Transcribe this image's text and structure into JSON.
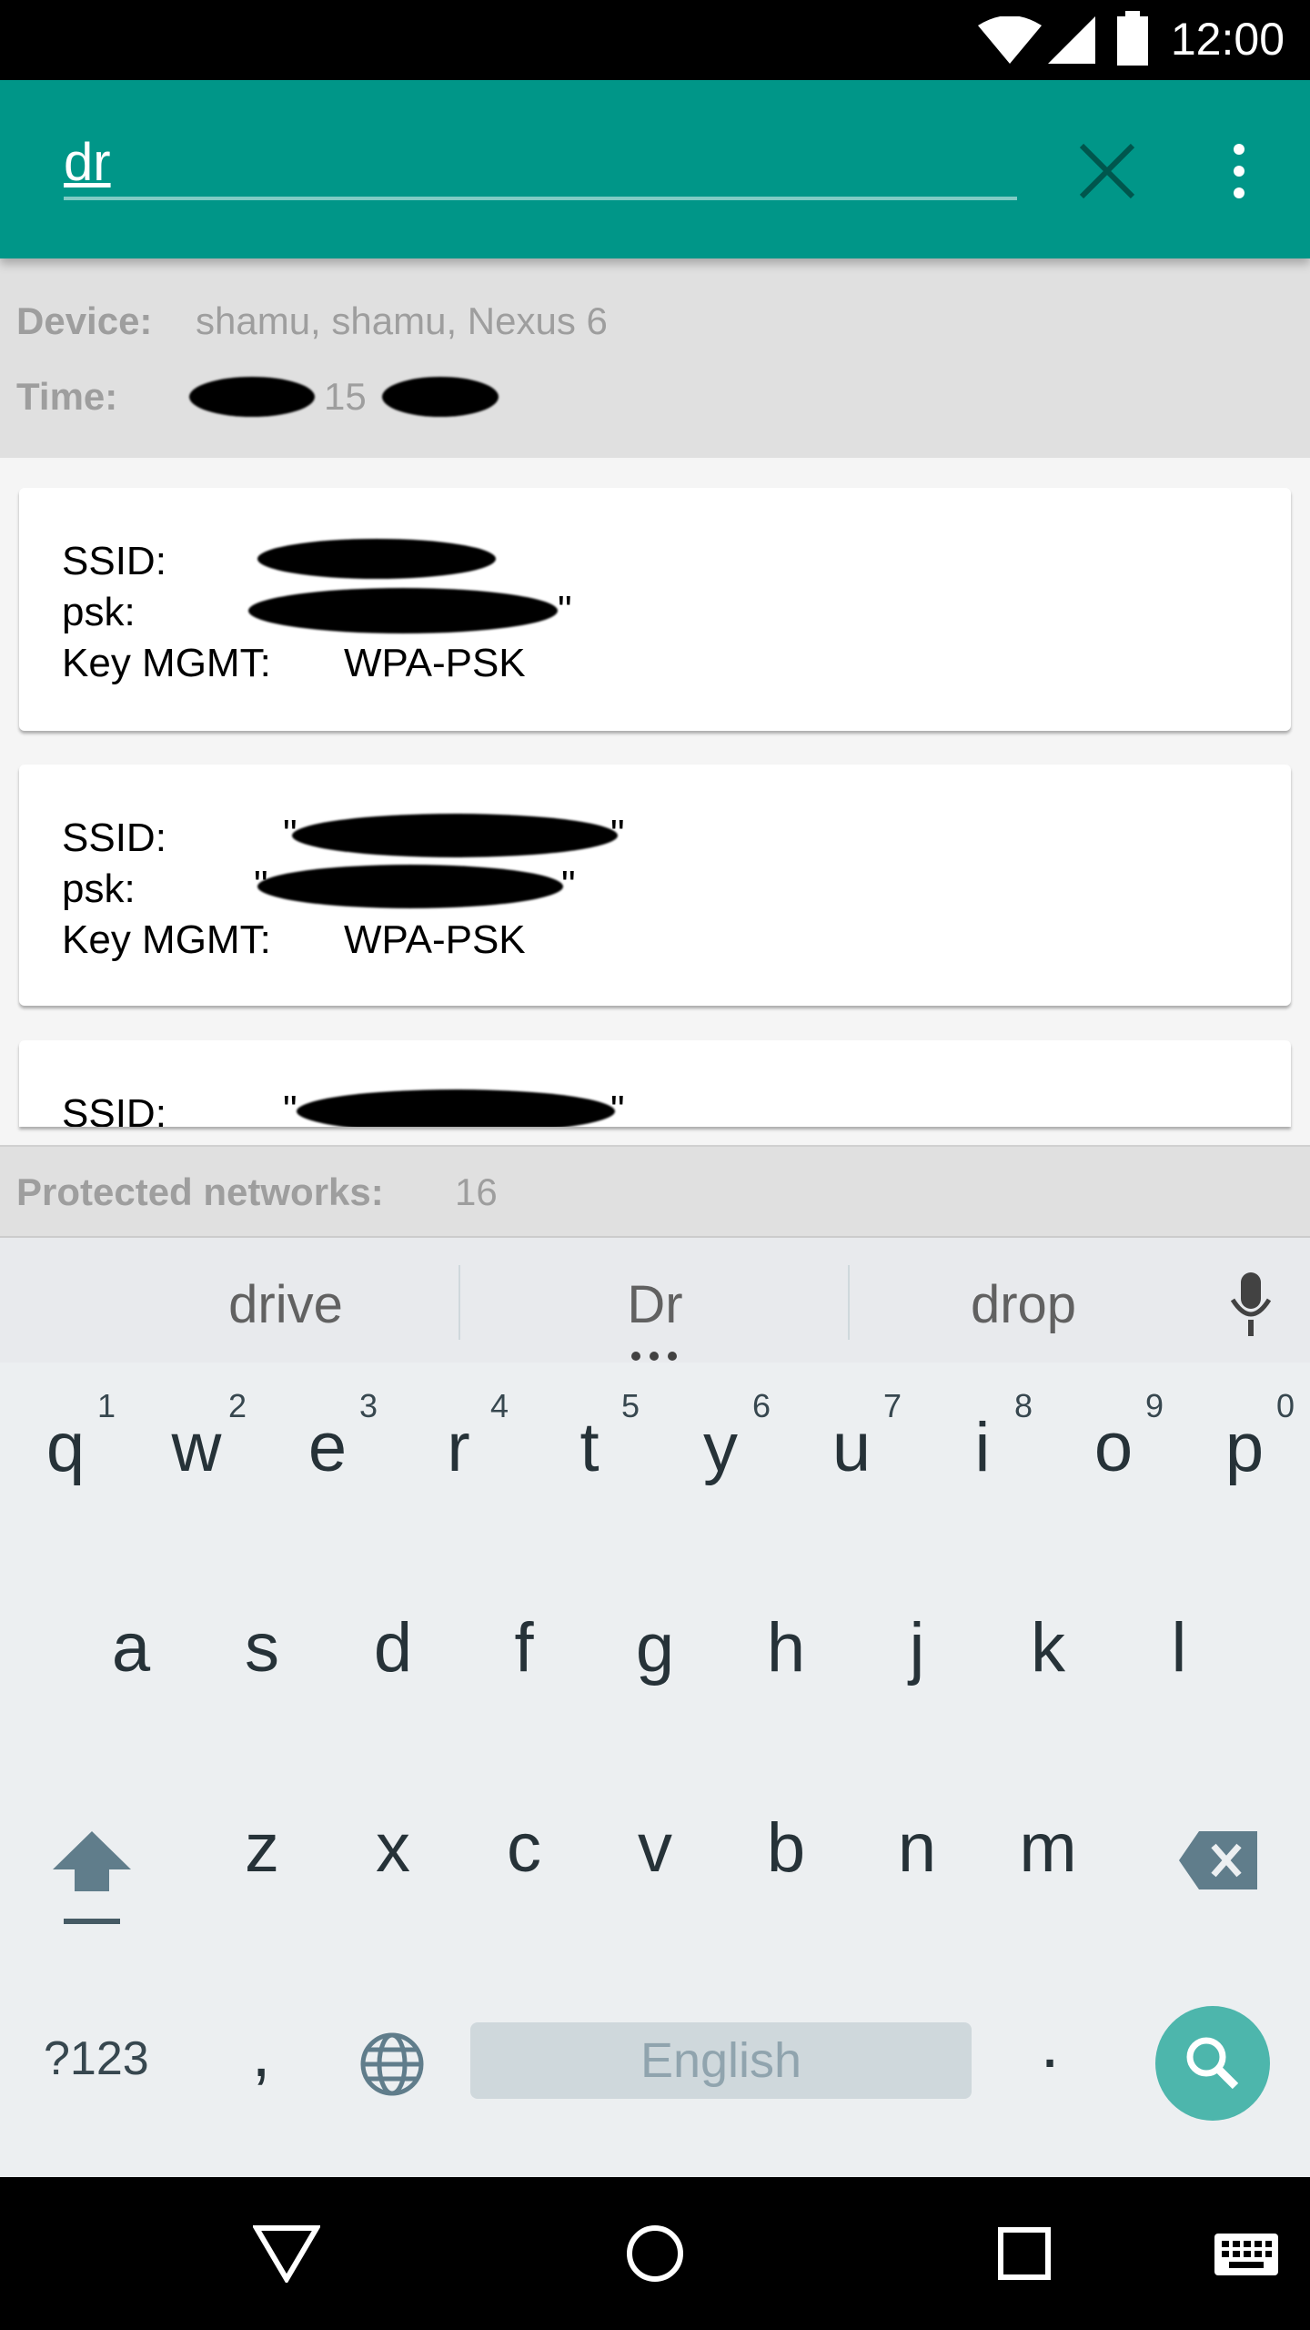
{
  "status_bar": {
    "time": "12:00",
    "icons": [
      "wifi-icon",
      "signal-icon",
      "battery-icon"
    ]
  },
  "toolbar": {
    "search_value": "dr",
    "clear_icon": "close-icon",
    "menu_icon": "more-vert-icon"
  },
  "info": {
    "device_label": "Device:",
    "device_value": "shamu, shamu, Nexus 6",
    "time_label": "Time:",
    "time_visible": "15"
  },
  "networks": [
    {
      "ssid_label": "SSID:",
      "psk_label": "psk:",
      "psk_suffix": "\"",
      "key_label": "Key MGMT:",
      "key_value": "WPA-PSK"
    },
    {
      "ssid_label": "SSID:",
      "ssid_prefix": "\"",
      "ssid_suffix": "\"",
      "psk_label": "psk:",
      "psk_prefix": "\"",
      "psk_suffix": "\"",
      "key_label": "Key MGMT:",
      "key_value": "WPA-PSK"
    },
    {
      "ssid_label": "SSID:",
      "ssid_prefix": "\"",
      "ssid_suffix": "\""
    }
  ],
  "footer": {
    "label": "Protected networks:",
    "count": "16"
  },
  "suggestions": [
    "drive",
    "Dr",
    "drop"
  ],
  "keyboard": {
    "row1": [
      "q",
      "w",
      "e",
      "r",
      "t",
      "y",
      "u",
      "i",
      "o",
      "p"
    ],
    "row1_numbers": [
      "1",
      "2",
      "3",
      "4",
      "5",
      "6",
      "7",
      "8",
      "9",
      "0"
    ],
    "row2": [
      "a",
      "s",
      "d",
      "f",
      "g",
      "h",
      "j",
      "k",
      "l"
    ],
    "row3": [
      "z",
      "x",
      "c",
      "v",
      "b",
      "n",
      "m"
    ],
    "symbols": "?123",
    "comma": ",",
    "space": "English",
    "period": ".",
    "accent": "#4db6ac"
  },
  "colors": {
    "primary": "#009688"
  }
}
